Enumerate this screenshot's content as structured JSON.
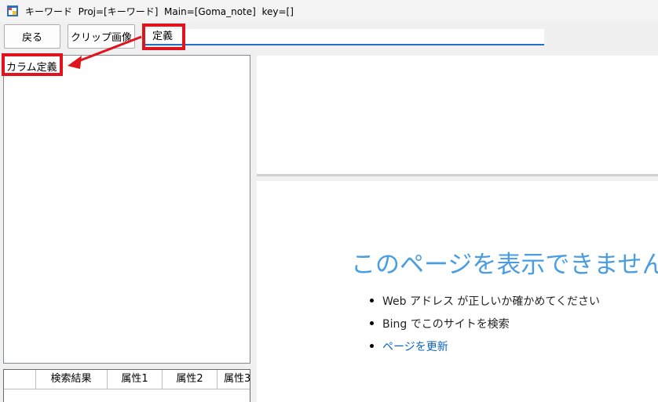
{
  "window": {
    "title": "キーワード  Proj=[キーワード]  Main=[Goma_note]  key=[]"
  },
  "toolbar": {
    "back_label": "戻る",
    "clip_image_label": "クリップ画像",
    "input_value": "定義"
  },
  "left_panel": {
    "label": "カラム定義"
  },
  "grid": {
    "columns": [
      "検索結果",
      "属性1",
      "属性2",
      "属性3"
    ]
  },
  "browser_error": {
    "title": "このページを表示できません",
    "items": [
      "Web アドレス が正しいか確かめてください",
      "Bing でこのサイトを検索",
      "ページを更新"
    ]
  },
  "colors": {
    "annotation": "#e0141e",
    "accent": "#1f6fc8",
    "error_title": "#4a9de0",
    "link": "#0a63c8"
  }
}
